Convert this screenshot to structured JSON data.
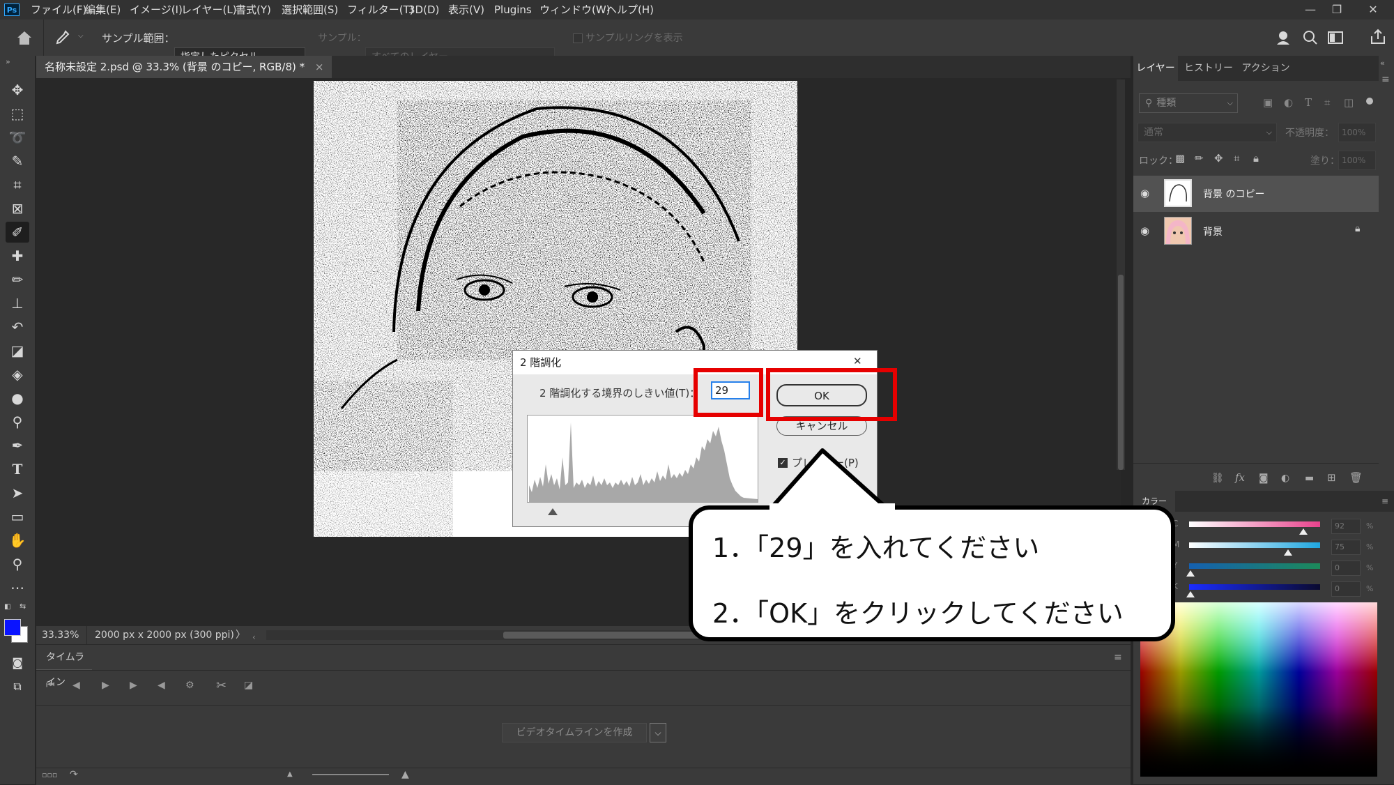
{
  "app": {
    "logo": "Ps"
  },
  "menu": [
    "ファイル(F)",
    "編集(E)",
    "イメージ(I)",
    "レイヤー(L)",
    "書式(Y)",
    "選択範囲(S)",
    "フィルター(T)",
    "3D(D)",
    "表示(V)",
    "Plugins",
    "ウィンドウ(W)",
    "ヘルプ(H)"
  ],
  "window_controls": {
    "minimize": "—",
    "restore": "❐",
    "close": "✕"
  },
  "options": {
    "sample_size_label": "サンプル範囲：",
    "sample_size_value": "指定したピクセル",
    "sample_label": "サンプル：",
    "sample_value": "すべてのレイヤー",
    "show_ring_label": "サンプルリングを表示"
  },
  "document_tab": {
    "title": "名称未設定 2.psd @ 33.3% (背景 のコピー, RGB/8) *",
    "close": "×"
  },
  "status": {
    "zoom": "33.33%",
    "doc_info": "2000 px x 2000 px (300 ppi)",
    "arrow": "〉"
  },
  "timeline": {
    "tab": "タイムライン",
    "create_button": "ビデオタイムラインを作成"
  },
  "panels": {
    "tabs": [
      "レイヤー",
      "ヒストリー",
      "アクション"
    ],
    "filter_placeholder": "種類",
    "blend_mode": "通常",
    "opacity_label": "不透明度：",
    "opacity_value": "100%",
    "lock_label": "ロック：",
    "fill_label": "塗り：",
    "fill_value": "100%",
    "layers": [
      {
        "name": "背景 のコピー",
        "selected": true
      },
      {
        "name": "背景",
        "locked": true
      }
    ],
    "color_tab": "カラー",
    "cmyk": [
      {
        "label": "C",
        "value": "92",
        "color": "#e8428c",
        "pct": 0.92
      },
      {
        "label": "M",
        "value": "75",
        "color": "#1fa7e0",
        "pct": 0.75
      },
      {
        "label": "Y",
        "value": "0",
        "color": "#1c8a5a",
        "pct": 0.0
      },
      {
        "label": "K",
        "value": "0",
        "color": "#0a0a30",
        "pct": 0.0
      }
    ],
    "percent": "%"
  },
  "dialog": {
    "title": "2 階調化",
    "close": "✕",
    "threshold_label": "2 階調化する境界のしきい値(T)：",
    "threshold_value": "29",
    "ok": "OK",
    "cancel": "キャンセル",
    "preview": "プレビュー(P)"
  },
  "callout": {
    "line1": "1．「29」を入れてください",
    "line2": "2．「OK」をクリックしてください"
  },
  "colors": {
    "foreground": "#0a14ff",
    "background": "#ffffff",
    "highlight": "#e60000"
  }
}
